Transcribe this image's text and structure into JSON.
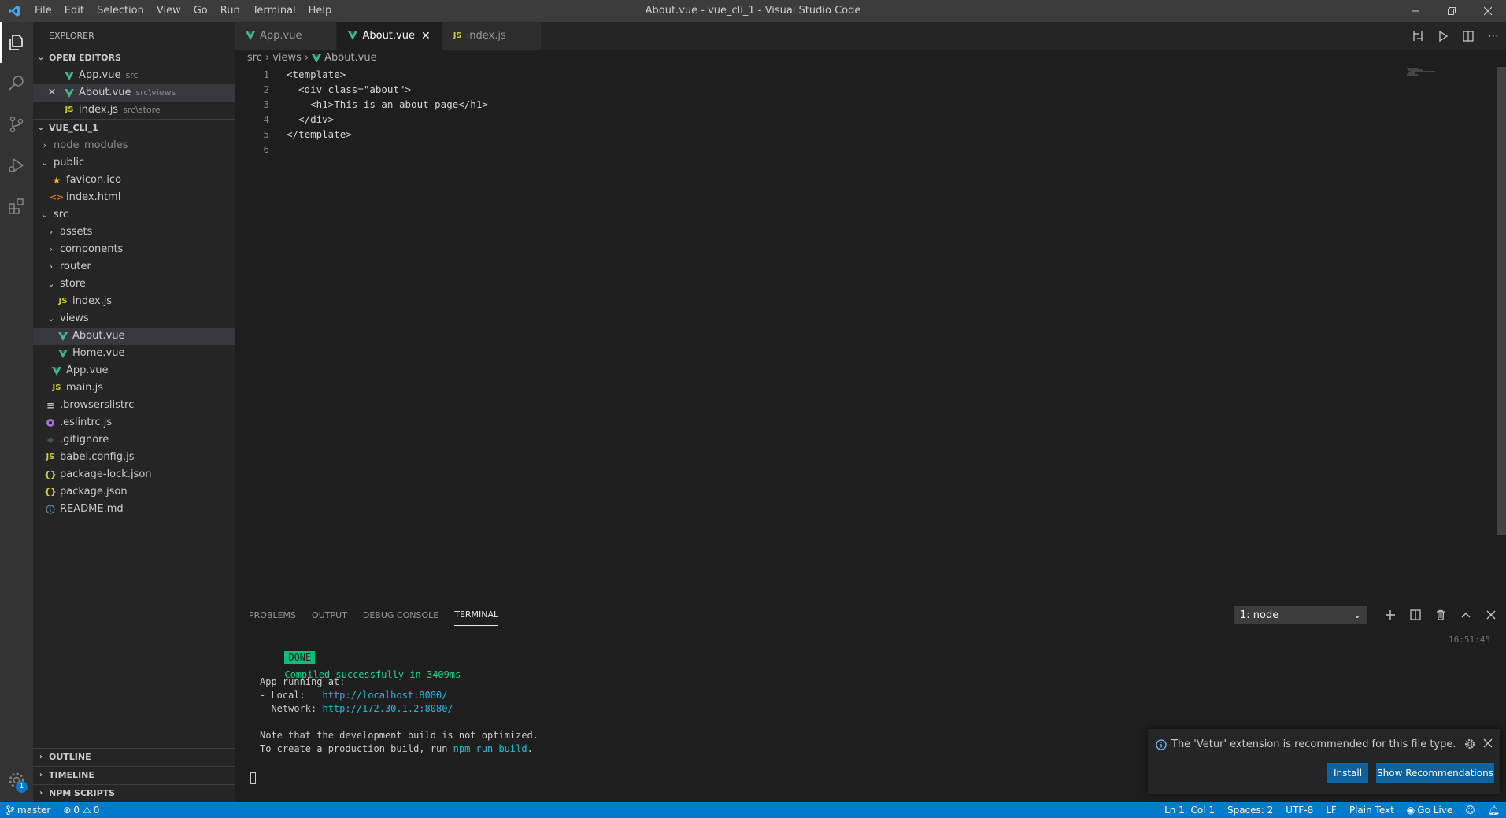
{
  "window": {
    "title": "About.vue - vue_cli_1 - Visual Studio Code"
  },
  "menu": [
    "File",
    "Edit",
    "Selection",
    "View",
    "Go",
    "Run",
    "Terminal",
    "Help"
  ],
  "sidebar": {
    "title": "EXPLORER",
    "open_editors": {
      "heading": "OPEN EDITORS",
      "items": [
        {
          "name": "App.vue",
          "desc": "src"
        },
        {
          "name": "About.vue",
          "desc": "src\\views"
        },
        {
          "name": "index.js",
          "desc": "src\\store"
        }
      ]
    },
    "project": {
      "heading": "VUE_CLI_1",
      "items": [
        {
          "label": "node_modules"
        },
        {
          "label": "public"
        },
        {
          "label": "favicon.ico"
        },
        {
          "label": "index.html"
        },
        {
          "label": "src"
        },
        {
          "label": "assets"
        },
        {
          "label": "components"
        },
        {
          "label": "router"
        },
        {
          "label": "store"
        },
        {
          "label": "index.js"
        },
        {
          "label": "views"
        },
        {
          "label": "About.vue"
        },
        {
          "label": "Home.vue"
        },
        {
          "label": "App.vue"
        },
        {
          "label": "main.js"
        },
        {
          "label": ".browserslistrc"
        },
        {
          "label": ".eslintrc.js"
        },
        {
          "label": ".gitignore"
        },
        {
          "label": "babel.config.js"
        },
        {
          "label": "package-lock.json"
        },
        {
          "label": "package.json"
        },
        {
          "label": "README.md"
        }
      ]
    },
    "bottom_sections": [
      "OUTLINE",
      "TIMELINE",
      "NPM SCRIPTS"
    ]
  },
  "tabs": [
    {
      "label": "App.vue"
    },
    {
      "label": "About.vue"
    },
    {
      "label": "index.js"
    }
  ],
  "breadcrumb": [
    "src",
    "views",
    "About.vue"
  ],
  "code": [
    {
      "n": "1",
      "text": "<template>"
    },
    {
      "n": "2",
      "text": "  <div class=\"about\">"
    },
    {
      "n": "3",
      "text": "    <h1>This is an about page</h1>"
    },
    {
      "n": "4",
      "text": "  </div>"
    },
    {
      "n": "5",
      "text": "</template>"
    },
    {
      "n": "6",
      "text": ""
    }
  ],
  "panel": {
    "tabs": [
      "PROBLEMS",
      "OUTPUT",
      "DEBUG CONSOLE",
      "TERMINAL"
    ],
    "terminal_select": "1: node",
    "time": "16:51:45",
    "done_badge": "DONE",
    "compiled": "Compiled successfully in 3409ms",
    "running": "App running at:",
    "local_label": "- Local:   ",
    "local_url": "http://localhost:8080/",
    "network_label": "- Network: ",
    "network_url": "http://172.30.1.2:8080/",
    "note1": "Note that the development build is not optimized.",
    "note2_prefix": "To create a production build, run ",
    "note2_cmd": "npm run build",
    "note2_suffix": "."
  },
  "notification": {
    "message": "The 'Vetur' extension is recommended for this file type.",
    "install": "Install",
    "show": "Show Recommendations"
  },
  "status": {
    "branch": "master",
    "errors": "0",
    "warnings": "0",
    "position": "Ln 1, Col 1",
    "spaces": "Spaces: 2",
    "encoding": "UTF-8",
    "eol": "LF",
    "language": "Plain Text",
    "golive": "Go Live",
    "settings_badge": "1"
  },
  "colors": {
    "accent": "#007acc",
    "vue": "#41b883",
    "js": "#cbcb41",
    "done": "#0dbc79"
  }
}
